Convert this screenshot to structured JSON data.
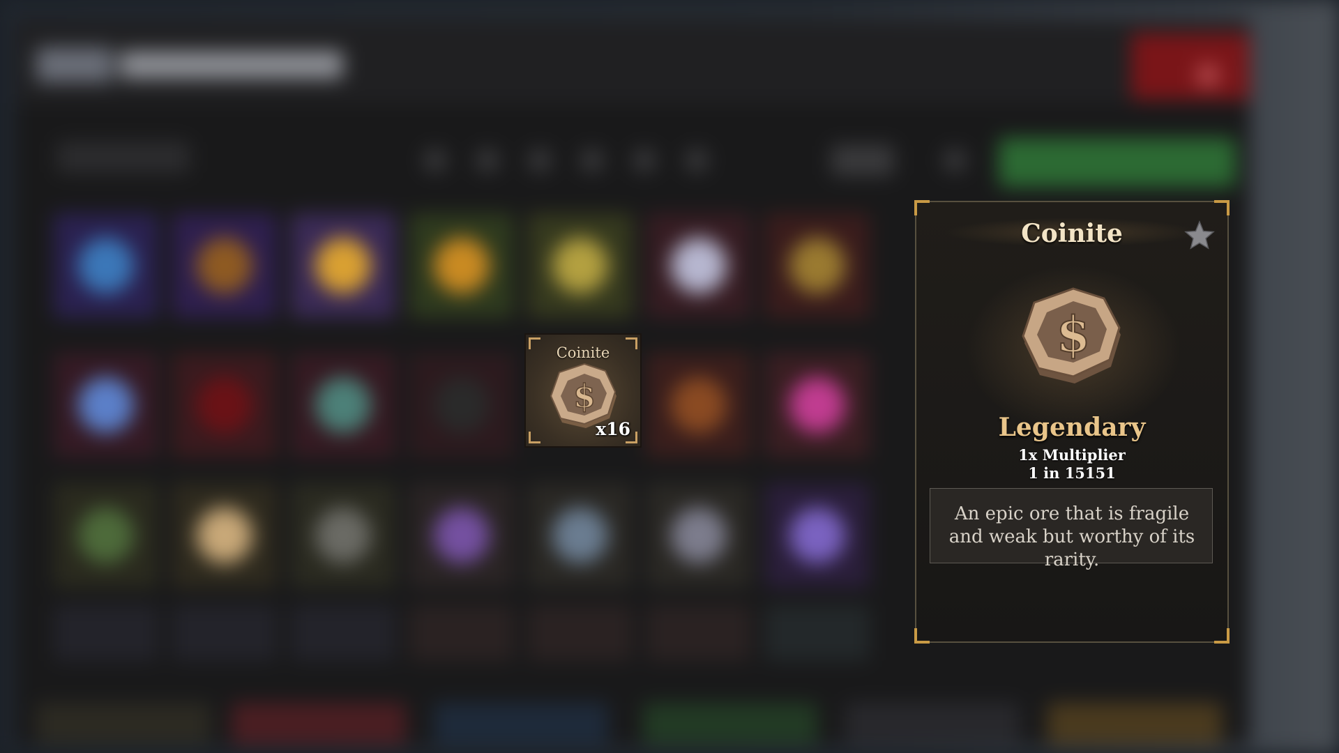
{
  "selected_slot": {
    "name": "Coinite",
    "quantity": "x16",
    "icon": "coin-icon"
  },
  "detail_panel": {
    "title": "Coinite",
    "rarity": "Legendary",
    "multiplier": "1x Multiplier",
    "chance": "1 in 15151",
    "description": "An epic ore that is fragile and weak but worthy of its rarity.",
    "favorite_icon": "star-icon",
    "item_icon": "coin-icon"
  },
  "colors": {
    "rarity_legendary": "#e9c58a",
    "title": "#f3e4c6",
    "accent_gold": "#c99a45",
    "coin": "#b8977a"
  }
}
